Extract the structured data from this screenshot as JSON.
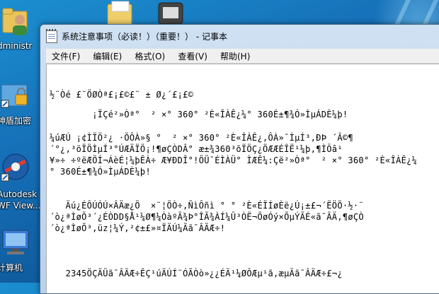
{
  "desktop": {
    "icons": [
      {
        "name": "administrator-folder",
        "label": "dministr"
      },
      {
        "name": "encrypt",
        "label": "神盾加密"
      },
      {
        "name": "autodesk-dwf",
        "label_line1": "Autodesk",
        "label_line2": "WF View..."
      },
      {
        "name": "computer",
        "label": "计算机"
      }
    ]
  },
  "window": {
    "title": "系统注意事项（必读！）（重要！） - 记事本",
    "menu": [
      {
        "id": "file",
        "label": "文件(F)"
      },
      {
        "id": "edit",
        "label": "编辑(E)"
      },
      {
        "id": "format",
        "label": "格式(O)"
      },
      {
        "id": "view",
        "label": "查看(V)"
      },
      {
        "id": "help",
        "label": "帮助(H)"
      }
    ],
    "lines": [
      "½¨Òé £¨ÖØÒª£¡£©£¨ ± Ø¿´£¡£©",
      "        ¡ÏÇé²»Òª°  ² ×° 360° ²È«ÎÀÊ¿¼° 360É±¶¾Ó»ÌµÁDÈ¼þ!",
      "¼úÆÚ ¡¢ÌÏÖ²¿ ·ÖÔÀ»§ °  ² ×° 360° ²È«ÎÀÊ¿,ÔÀ»¯ÌµÍ³,ÐÞ ´Â©¶",
      "´°¿,³öÏÖÌµÍ³°ÚÆÄÏÖ¡!¶øÇÒDÂ° æ±¾360³õÏÖÇ¿ÖÆÆÉÎË¹¼þ,¶ÌÔâ¹",
      "¥»÷ ÷ºëÆÖÍ¬ÁèÉ¦¼þÊÀ÷ Æ¥ÐDÎ°!ÖÜ¯ÉÌÀÜ° ÌÆÊ¼:Çë²»Òª°  ² ×° 360° ²È«ÎÀÊ¿¼",
      "° 360É±¶¾Ó»ÌµÁDÈ¼þ!",
      "",
      "",
      "   Äú¿ÉÔÚÓÚ×ÂÄæ¿Ö  ×¨¦ÖÒ÷,ÑìÔñì ° ° ²È«ÉÏÍøÈë¿Ú¡±£¬´ËÖÖ·½·¨",
      "´ò¿ªÌøÕ³´¿ÉÒDD§Å¹¼Ø¶¼ÒàºÃ¾Þ°ÎÃ¾ÀÍ¼Û³ÒË¬ÕøÓý×ÕµÝÃÉ«ã¯ÂÄ,¶øÇÒ",
      "´ò¿ªÌøÕ³,üz¦¼Ý,²¢±£»¤ÏÄÚ¼Ãã¯ÂÄÆ÷!",
      "",
      "",
      "   2345ÖÇÄÜã¯ÂÄÆ÷ÊÇ¹úÄÚÍ¨ÓÃÒò»¿¿ÉÄ¹¼ØÔÆµ¹ã,æµÄã¯ÂÄÆ÷£¬¿"
    ]
  }
}
